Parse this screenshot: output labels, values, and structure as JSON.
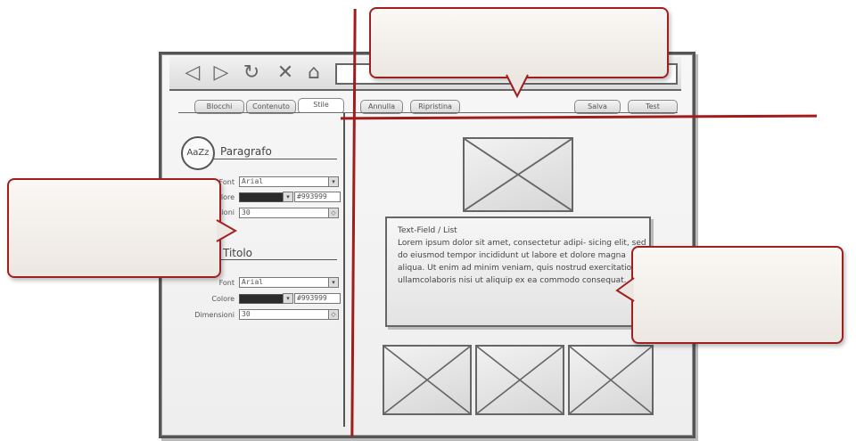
{
  "toolbar": {
    "icons": [
      "back-icon",
      "forward-icon",
      "reload-icon",
      "close-icon",
      "home-icon"
    ]
  },
  "tabs": {
    "blocchi": "Blocchi",
    "contenuto": "Contenuto",
    "stile": "Stile",
    "annulla": "Annulla",
    "ripristina": "Ripristina",
    "salva": "Salva",
    "test": "Test"
  },
  "logo": {
    "text": "AaZz"
  },
  "paragrafo": {
    "title": "Paragrafo",
    "font_label": "Font",
    "font_value": "Arial",
    "colore_label": "Colore",
    "colore_hex": "#993999",
    "dimensioni_label": "Dimensioni",
    "dimensioni_value": "30"
  },
  "titolo": {
    "title": "Titolo",
    "font_label": "Font",
    "font_value": "Arial",
    "colore_label": "Colore",
    "colore_hex": "#993999",
    "dimensioni_label": "Dimensioni",
    "dimensioni_value": "30"
  },
  "content": {
    "textfield_title": "Text-Field / List",
    "textfield_body": "Lorem ipsum dolor sit amet, consectetur adipi- sicing elit, sed do eiusmod tempor incididunt ut labore et dolore magna aliqua. Ut enim ad minim veniam, quis nostrud exercitation ullamcolaboris nisi ut aliquip ex ea commodo consequat."
  },
  "colors": {
    "accent_red": "#a11c1c",
    "frame": "#555555"
  }
}
